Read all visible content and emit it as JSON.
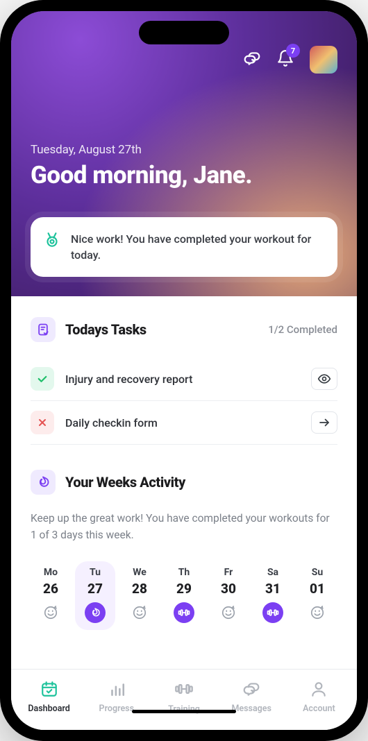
{
  "header": {
    "notification_count": "7",
    "date": "Tuesday, August 27th",
    "greeting": "Good morning, Jane."
  },
  "banner": {
    "text": "Nice work! You have completed your workout for today."
  },
  "tasks": {
    "title": "Todays Tasks",
    "meta": "1/2 Completed",
    "items": [
      {
        "label": "Injury and recovery report",
        "status": "done",
        "action": "view"
      },
      {
        "label": "Daily checkin form",
        "status": "pending",
        "action": "go"
      }
    ]
  },
  "activity": {
    "title": "Your Weeks Activity",
    "subtext": "Keep up the great work! You have completed your workouts for 1 of 3 days this week.",
    "days": [
      {
        "name": "Mo",
        "num": "26",
        "kind": "rest",
        "selected": false
      },
      {
        "name": "Tu",
        "num": "27",
        "kind": "fire-solid",
        "selected": true
      },
      {
        "name": "We",
        "num": "28",
        "kind": "rest",
        "selected": false
      },
      {
        "name": "Th",
        "num": "29",
        "kind": "weight-solid",
        "selected": false
      },
      {
        "name": "Fr",
        "num": "30",
        "kind": "rest",
        "selected": false
      },
      {
        "name": "Sa",
        "num": "31",
        "kind": "weight-solid",
        "selected": false
      },
      {
        "name": "Su",
        "num": "01",
        "kind": "rest",
        "selected": false
      }
    ]
  },
  "tabs": [
    {
      "label": "Dashboard",
      "icon": "calendar",
      "active": true
    },
    {
      "label": "Progress",
      "icon": "bars",
      "active": false
    },
    {
      "label": "Training",
      "icon": "dumbbell",
      "active": false
    },
    {
      "label": "Messages",
      "icon": "chat",
      "active": false
    },
    {
      "label": "Account",
      "icon": "user",
      "active": false
    }
  ],
  "colors": {
    "accent_purple": "#7b3ff2",
    "accent_green": "#1dc29b",
    "danger": "#e55353"
  }
}
